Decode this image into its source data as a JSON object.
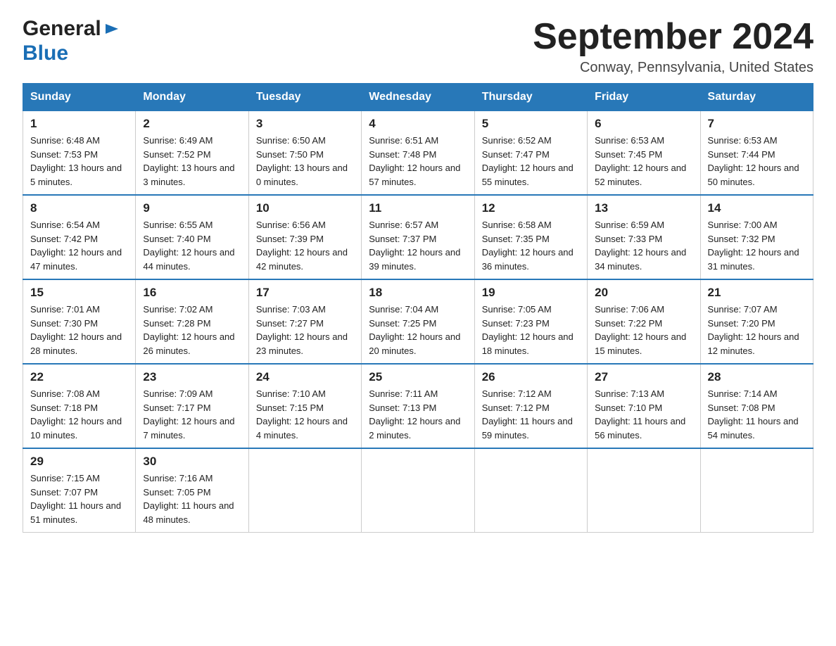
{
  "logo": {
    "text_general": "General",
    "text_blue": "Blue",
    "arrow_alt": "arrow"
  },
  "title": {
    "month_year": "September 2024",
    "location": "Conway, Pennsylvania, United States"
  },
  "weekdays": [
    "Sunday",
    "Monday",
    "Tuesday",
    "Wednesday",
    "Thursday",
    "Friday",
    "Saturday"
  ],
  "weeks": [
    [
      {
        "day": "1",
        "sunrise": "6:48 AM",
        "sunset": "7:53 PM",
        "daylight": "13 hours and 5 minutes."
      },
      {
        "day": "2",
        "sunrise": "6:49 AM",
        "sunset": "7:52 PM",
        "daylight": "13 hours and 3 minutes."
      },
      {
        "day": "3",
        "sunrise": "6:50 AM",
        "sunset": "7:50 PM",
        "daylight": "13 hours and 0 minutes."
      },
      {
        "day": "4",
        "sunrise": "6:51 AM",
        "sunset": "7:48 PM",
        "daylight": "12 hours and 57 minutes."
      },
      {
        "day": "5",
        "sunrise": "6:52 AM",
        "sunset": "7:47 PM",
        "daylight": "12 hours and 55 minutes."
      },
      {
        "day": "6",
        "sunrise": "6:53 AM",
        "sunset": "7:45 PM",
        "daylight": "12 hours and 52 minutes."
      },
      {
        "day": "7",
        "sunrise": "6:53 AM",
        "sunset": "7:44 PM",
        "daylight": "12 hours and 50 minutes."
      }
    ],
    [
      {
        "day": "8",
        "sunrise": "6:54 AM",
        "sunset": "7:42 PM",
        "daylight": "12 hours and 47 minutes."
      },
      {
        "day": "9",
        "sunrise": "6:55 AM",
        "sunset": "7:40 PM",
        "daylight": "12 hours and 44 minutes."
      },
      {
        "day": "10",
        "sunrise": "6:56 AM",
        "sunset": "7:39 PM",
        "daylight": "12 hours and 42 minutes."
      },
      {
        "day": "11",
        "sunrise": "6:57 AM",
        "sunset": "7:37 PM",
        "daylight": "12 hours and 39 minutes."
      },
      {
        "day": "12",
        "sunrise": "6:58 AM",
        "sunset": "7:35 PM",
        "daylight": "12 hours and 36 minutes."
      },
      {
        "day": "13",
        "sunrise": "6:59 AM",
        "sunset": "7:33 PM",
        "daylight": "12 hours and 34 minutes."
      },
      {
        "day": "14",
        "sunrise": "7:00 AM",
        "sunset": "7:32 PM",
        "daylight": "12 hours and 31 minutes."
      }
    ],
    [
      {
        "day": "15",
        "sunrise": "7:01 AM",
        "sunset": "7:30 PM",
        "daylight": "12 hours and 28 minutes."
      },
      {
        "day": "16",
        "sunrise": "7:02 AM",
        "sunset": "7:28 PM",
        "daylight": "12 hours and 26 minutes."
      },
      {
        "day": "17",
        "sunrise": "7:03 AM",
        "sunset": "7:27 PM",
        "daylight": "12 hours and 23 minutes."
      },
      {
        "day": "18",
        "sunrise": "7:04 AM",
        "sunset": "7:25 PM",
        "daylight": "12 hours and 20 minutes."
      },
      {
        "day": "19",
        "sunrise": "7:05 AM",
        "sunset": "7:23 PM",
        "daylight": "12 hours and 18 minutes."
      },
      {
        "day": "20",
        "sunrise": "7:06 AM",
        "sunset": "7:22 PM",
        "daylight": "12 hours and 15 minutes."
      },
      {
        "day": "21",
        "sunrise": "7:07 AM",
        "sunset": "7:20 PM",
        "daylight": "12 hours and 12 minutes."
      }
    ],
    [
      {
        "day": "22",
        "sunrise": "7:08 AM",
        "sunset": "7:18 PM",
        "daylight": "12 hours and 10 minutes."
      },
      {
        "day": "23",
        "sunrise": "7:09 AM",
        "sunset": "7:17 PM",
        "daylight": "12 hours and 7 minutes."
      },
      {
        "day": "24",
        "sunrise": "7:10 AM",
        "sunset": "7:15 PM",
        "daylight": "12 hours and 4 minutes."
      },
      {
        "day": "25",
        "sunrise": "7:11 AM",
        "sunset": "7:13 PM",
        "daylight": "12 hours and 2 minutes."
      },
      {
        "day": "26",
        "sunrise": "7:12 AM",
        "sunset": "7:12 PM",
        "daylight": "11 hours and 59 minutes."
      },
      {
        "day": "27",
        "sunrise": "7:13 AM",
        "sunset": "7:10 PM",
        "daylight": "11 hours and 56 minutes."
      },
      {
        "day": "28",
        "sunrise": "7:14 AM",
        "sunset": "7:08 PM",
        "daylight": "11 hours and 54 minutes."
      }
    ],
    [
      {
        "day": "29",
        "sunrise": "7:15 AM",
        "sunset": "7:07 PM",
        "daylight": "11 hours and 51 minutes."
      },
      {
        "day": "30",
        "sunrise": "7:16 AM",
        "sunset": "7:05 PM",
        "daylight": "11 hours and 48 minutes."
      },
      null,
      null,
      null,
      null,
      null
    ]
  ],
  "labels": {
    "sunrise": "Sunrise:",
    "sunset": "Sunset:",
    "daylight": "Daylight:"
  }
}
